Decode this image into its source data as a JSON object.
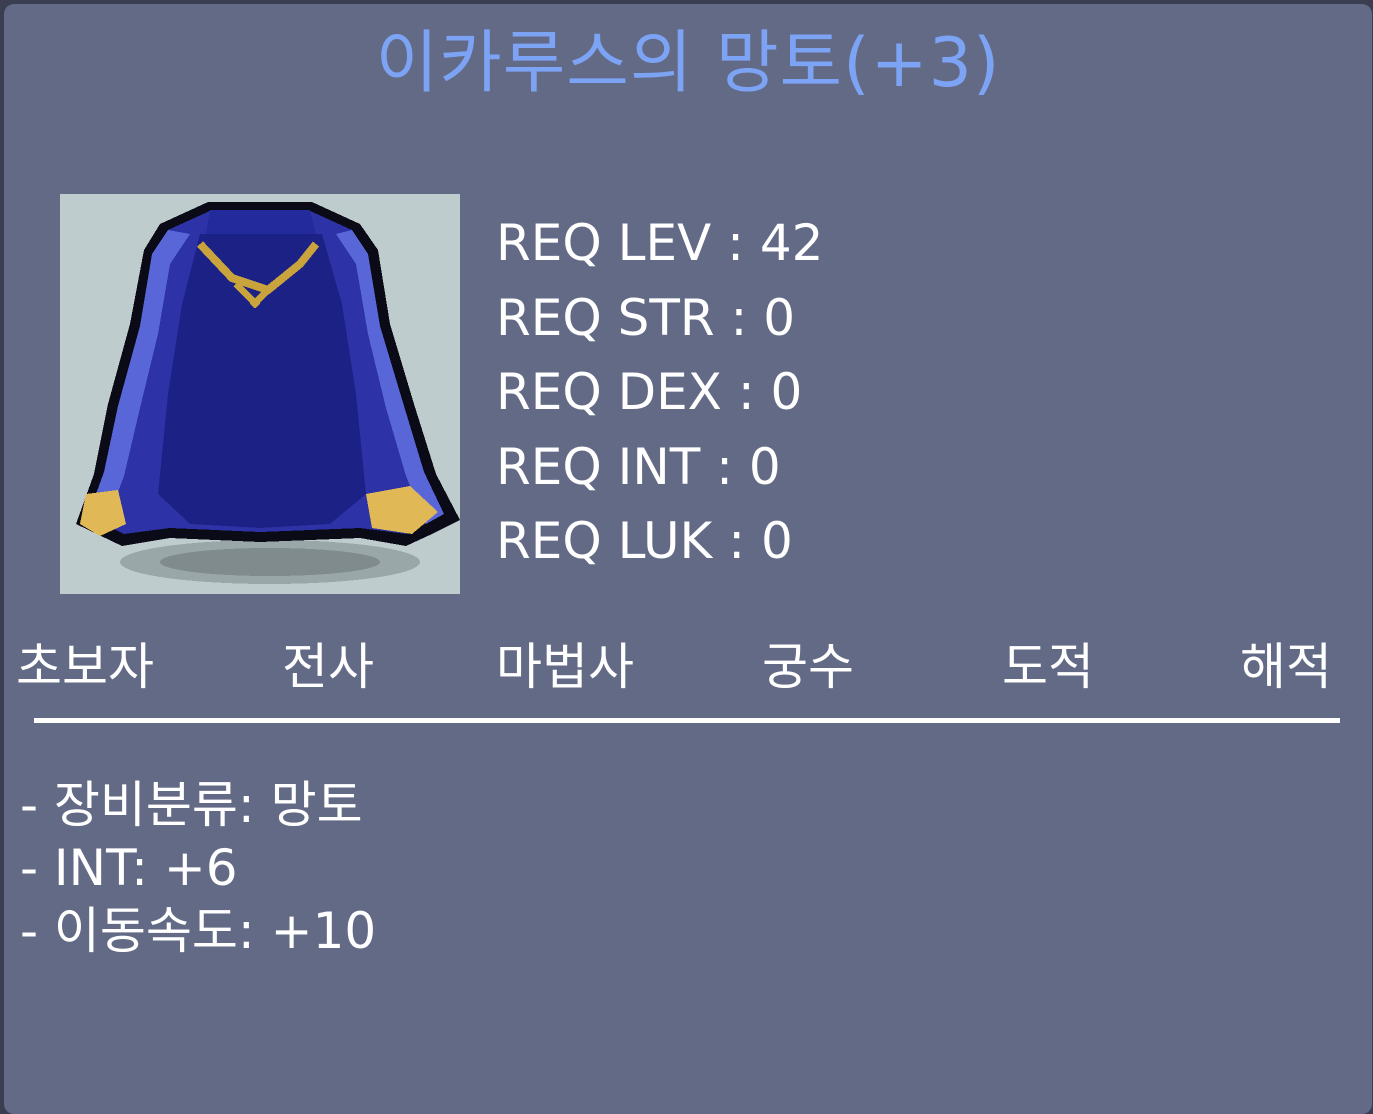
{
  "item": {
    "title": "이카루스의 망토(+3)",
    "icon": "blue-cape-icon",
    "title_color": "#7da3f5"
  },
  "requirements": [
    {
      "text": "REQ LEV : 42"
    },
    {
      "text": "REQ STR : 0"
    },
    {
      "text": "REQ DEX : 0"
    },
    {
      "text": "REQ INT : 0"
    },
    {
      "text": "REQ LUK : 0"
    }
  ],
  "jobs": [
    {
      "label": "초보자"
    },
    {
      "label": "전사"
    },
    {
      "label": "마법사"
    },
    {
      "label": "궁수"
    },
    {
      "label": "도적"
    },
    {
      "label": "해적"
    }
  ],
  "stats": [
    {
      "text": "- 장비분류: 망토"
    },
    {
      "text": "- INT: +6"
    },
    {
      "text": "- 이동속도: +10"
    }
  ]
}
